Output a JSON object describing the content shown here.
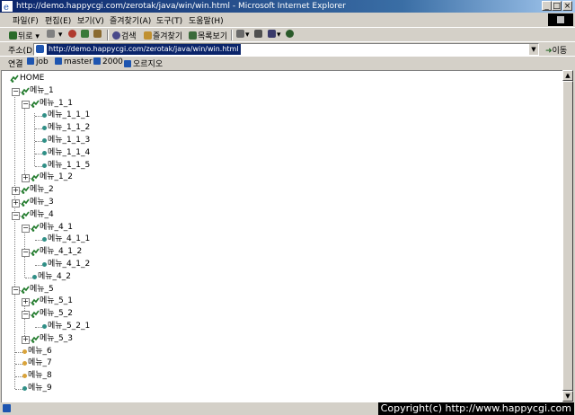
{
  "window": {
    "title": "http://demo.happycgi.com/zerotak/java/win/win.html - Microsoft Internet Explorer",
    "controls": {
      "minimize": "_",
      "maximize": "□",
      "close": "×"
    }
  },
  "menu": [
    "파일(F)",
    "편집(E)",
    "보기(V)",
    "즐겨찾기(A)",
    "도구(T)",
    "도움말(H)"
  ],
  "toolbar": {
    "back": "뒤로",
    "search": "검색",
    "favorites": "즐겨찾기",
    "history": "목록보기",
    "icons": [
      "back-arrow-icon",
      "forward-arrow-icon",
      "stop-icon",
      "refresh-icon",
      "home-icon",
      "search-icon",
      "favorites-icon",
      "history-icon",
      "mail-icon",
      "print-icon",
      "edit-icon",
      "messenger-icon"
    ]
  },
  "address": {
    "label": "주소(D)",
    "url": "http://demo.happycgi.com/zerotak/java/win/win.html",
    "go": "이동"
  },
  "links": {
    "label": "연결",
    "items": [
      "job",
      "master",
      "2000",
      "오르지오"
    ]
  },
  "tree": {
    "home": "HOME",
    "nodes": [
      "메뉴_1",
      "메뉴_1_1",
      "메뉴_1_1_1",
      "메뉴_1_1_2",
      "메뉴_1_1_3",
      "메뉴_1_1_4",
      "메뉴_1_1_5",
      "메뉴_1_2",
      "메뉴_2",
      "메뉴_3",
      "메뉴_4",
      "메뉴_4_1",
      "메뉴_4_1_1",
      "메뉴_4_1_2",
      "메뉴_4_1_2",
      "메뉴_4_2",
      "메뉴_5",
      "메뉴_5_1",
      "메뉴_5_2",
      "메뉴_5_2_1",
      "메뉴_5_3",
      "메뉴_6",
      "메뉴_7",
      "메뉴_8",
      "메뉴_9"
    ],
    "colors": {
      "folder_green": "#1f7a2a",
      "leaf_teal": "#2f8f86",
      "leaf_gold": "#d9a33a"
    }
  },
  "status": {
    "copyright": "Copyright(c) http://www.happycgi.com"
  }
}
